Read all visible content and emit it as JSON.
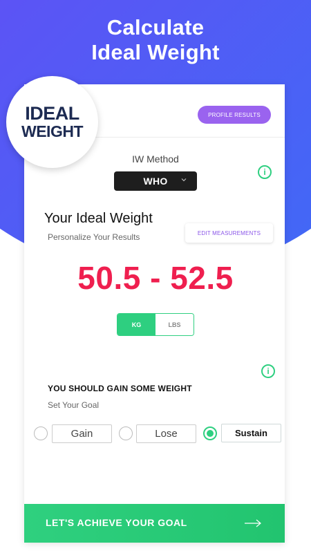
{
  "headline": {
    "line1": "Calculate",
    "line2": "Ideal Weight"
  },
  "logo": {
    "line1": "IDEAL",
    "line2": "WEIGHT"
  },
  "header": {
    "profile_button": "PROFILE RESULTS"
  },
  "method": {
    "label": "IW Method",
    "selected": "WHO"
  },
  "result": {
    "title": "Your Ideal Weight",
    "subtitle": "Personalize Your Results",
    "edit_button": "EDIT MEASUREMENTS",
    "range": "50.5 - 52.5"
  },
  "units": {
    "kg": "KG",
    "lbs": "LBS",
    "selected": "KG"
  },
  "goal": {
    "advice": "YOU SHOULD GAIN SOME WEIGHT",
    "label": "Set Your Goal",
    "options": [
      "Gain",
      "Lose",
      "Sustain"
    ],
    "selected": "Sustain"
  },
  "cta": {
    "label": "LET'S ACHIEVE YOUR GOAL"
  },
  "colors": {
    "accent_green": "#2ecf80",
    "accent_purple": "#9a63ef",
    "range_red": "#ef1f4f",
    "gradient_start": "#7a3cf0",
    "gradient_end": "#3a6ef6"
  }
}
